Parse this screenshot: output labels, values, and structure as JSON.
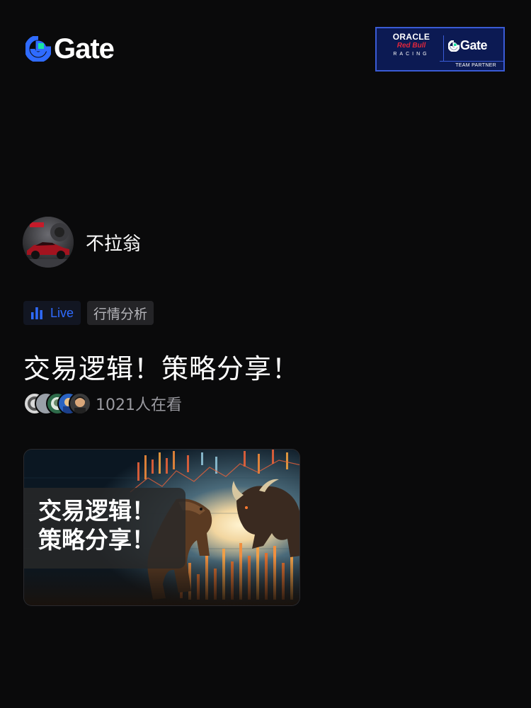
{
  "header": {
    "brand": "Gate",
    "partner": {
      "oracle": "ORACLE",
      "redbull": "Red Bull",
      "racing": "RACING",
      "gate": "Gate",
      "team": "TEAM PARTNER"
    }
  },
  "host": {
    "name": "不拉翁"
  },
  "tags": {
    "live": "Live",
    "category": "行情分析"
  },
  "stream": {
    "title": "交易逻辑！策略分享！",
    "viewers": "1021人在看"
  },
  "cover": {
    "line1": "交易逻辑！",
    "line2": "策略分享！"
  },
  "colors": {
    "background": "#0a0a0b",
    "accent": "#2f6bff",
    "brand_green": "#17e5a0"
  }
}
